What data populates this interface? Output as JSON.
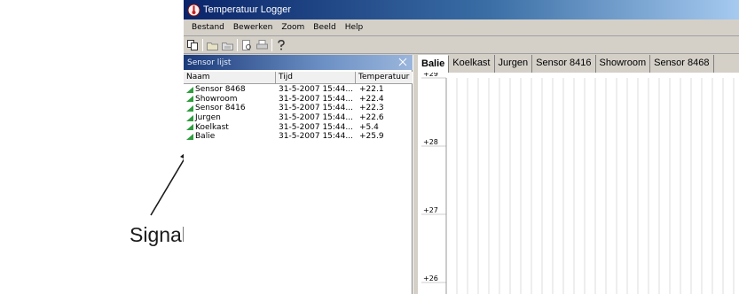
{
  "annotation": {
    "label": "Signalleistung"
  },
  "window": {
    "title": "Temperatuur Logger"
  },
  "menu": [
    "Bestand",
    "Bewerken",
    "Zoom",
    "Beeld",
    "Help"
  ],
  "toolbar": {
    "icons": [
      "copy-icon",
      "open-icon",
      "save-icon",
      "print-preview-icon",
      "print-icon",
      "help-icon"
    ]
  },
  "sensor_list": {
    "title": "Sensor lijst",
    "columns": [
      "Naam",
      "Tijd",
      "Temperatuur"
    ],
    "rows": [
      {
        "naam": "Sensor 8468",
        "tijd": "31-5-2007 15:44...",
        "temp": "+22.1"
      },
      {
        "naam": "Showroom",
        "tijd": "31-5-2007 15:44...",
        "temp": "+22.4"
      },
      {
        "naam": "Sensor 8416",
        "tijd": "31-5-2007 15:44...",
        "temp": "+22.3"
      },
      {
        "naam": "Jurgen",
        "tijd": "31-5-2007 15:44...",
        "temp": "+22.6"
      },
      {
        "naam": "Koelkast",
        "tijd": "31-5-2007 15:44...",
        "temp": "+5.4"
      },
      {
        "naam": "Balie",
        "tijd": "31-5-2007 15:44...",
        "temp": "+25.9"
      }
    ]
  },
  "chart": {
    "tabs": [
      "Balie",
      "Koelkast",
      "Jurgen",
      "Sensor 8416",
      "Showroom",
      "Sensor 8468"
    ],
    "active_tab": "Balie",
    "y_ticks": [
      "+29",
      "+28",
      "+27",
      "+26"
    ],
    "grid": true
  },
  "colors": {
    "signal": "#2e9e3e",
    "title_bar": "#0a246a",
    "grid": "#c8c8c8"
  }
}
